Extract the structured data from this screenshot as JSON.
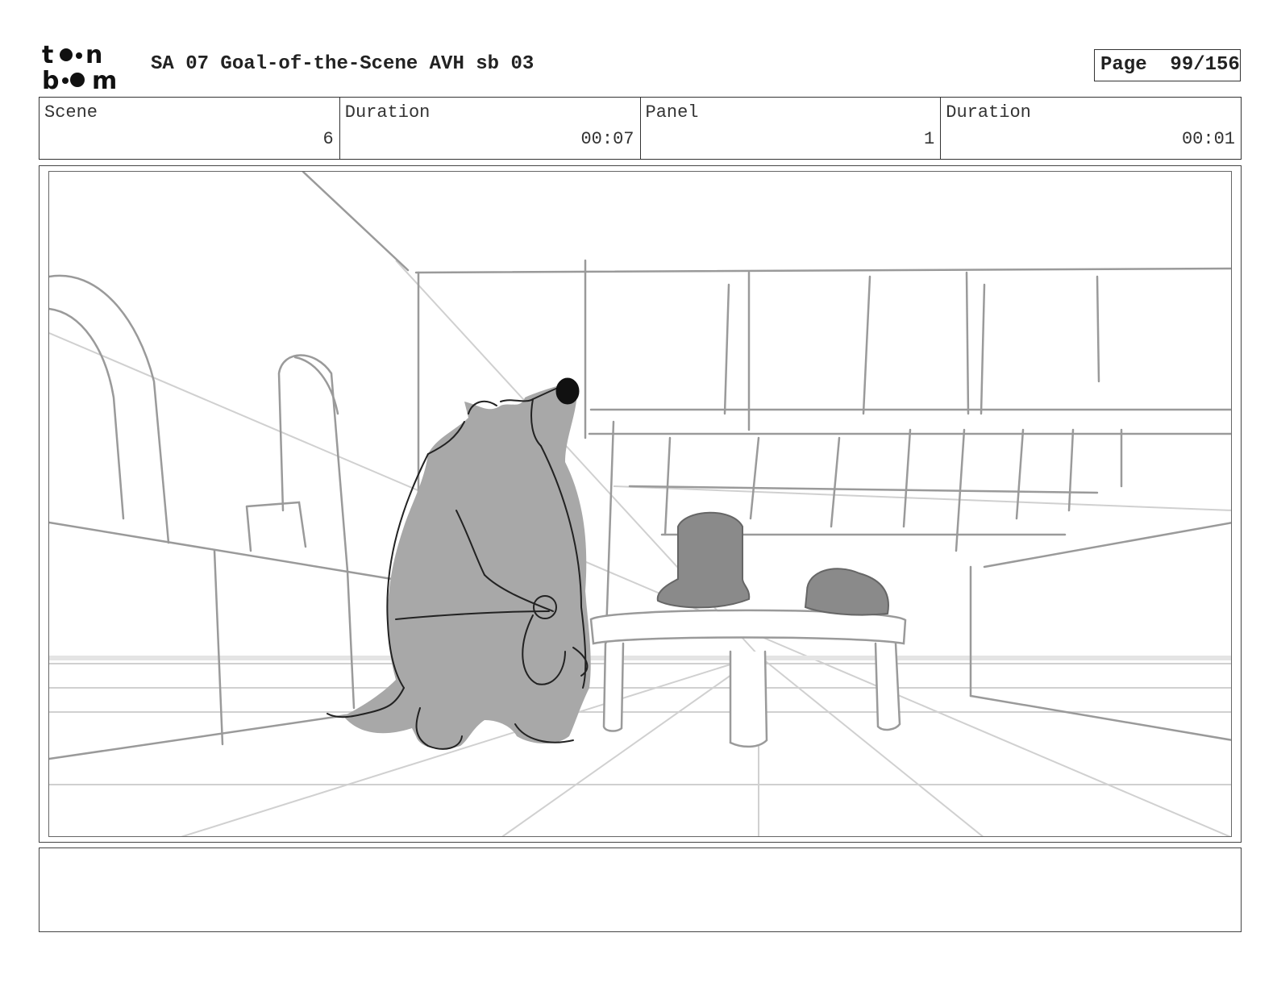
{
  "header": {
    "logo_text": "toon boom",
    "title": "SA 07 Goal-of-the-Scene AVH sb 03",
    "page_label": "Page",
    "page_value": "99/156"
  },
  "info": {
    "scene_label": "Scene",
    "scene_value": "6",
    "scene_duration_label": "Duration",
    "scene_duration_value": "00:07",
    "panel_label": "Panel",
    "panel_value": "1",
    "panel_duration_label": "Duration",
    "panel_duration_value": "00:01"
  },
  "notes": {
    "text": ""
  }
}
